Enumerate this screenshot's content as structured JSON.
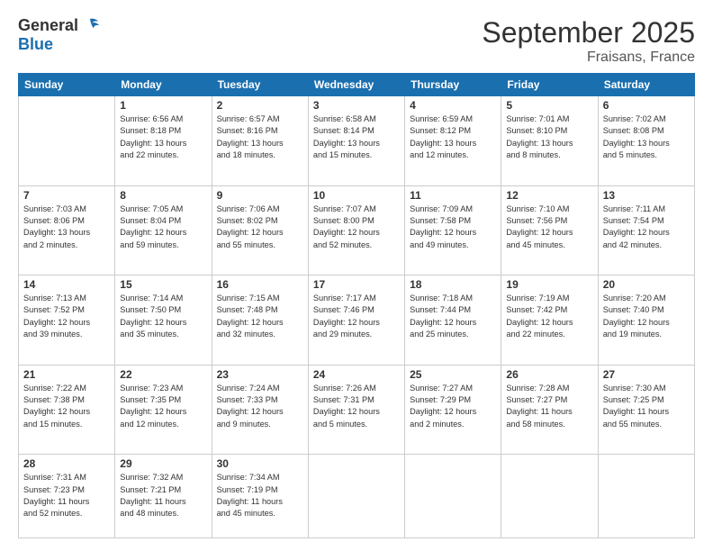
{
  "logo": {
    "general": "General",
    "blue": "Blue"
  },
  "header": {
    "month": "September 2025",
    "location": "Fraisans, France"
  },
  "weekdays": [
    "Sunday",
    "Monday",
    "Tuesday",
    "Wednesday",
    "Thursday",
    "Friday",
    "Saturday"
  ],
  "weeks": [
    [
      {
        "day": "",
        "info": ""
      },
      {
        "day": "1",
        "info": "Sunrise: 6:56 AM\nSunset: 8:18 PM\nDaylight: 13 hours\nand 22 minutes."
      },
      {
        "day": "2",
        "info": "Sunrise: 6:57 AM\nSunset: 8:16 PM\nDaylight: 13 hours\nand 18 minutes."
      },
      {
        "day": "3",
        "info": "Sunrise: 6:58 AM\nSunset: 8:14 PM\nDaylight: 13 hours\nand 15 minutes."
      },
      {
        "day": "4",
        "info": "Sunrise: 6:59 AM\nSunset: 8:12 PM\nDaylight: 13 hours\nand 12 minutes."
      },
      {
        "day": "5",
        "info": "Sunrise: 7:01 AM\nSunset: 8:10 PM\nDaylight: 13 hours\nand 8 minutes."
      },
      {
        "day": "6",
        "info": "Sunrise: 7:02 AM\nSunset: 8:08 PM\nDaylight: 13 hours\nand 5 minutes."
      }
    ],
    [
      {
        "day": "7",
        "info": "Sunrise: 7:03 AM\nSunset: 8:06 PM\nDaylight: 13 hours\nand 2 minutes."
      },
      {
        "day": "8",
        "info": "Sunrise: 7:05 AM\nSunset: 8:04 PM\nDaylight: 12 hours\nand 59 minutes."
      },
      {
        "day": "9",
        "info": "Sunrise: 7:06 AM\nSunset: 8:02 PM\nDaylight: 12 hours\nand 55 minutes."
      },
      {
        "day": "10",
        "info": "Sunrise: 7:07 AM\nSunset: 8:00 PM\nDaylight: 12 hours\nand 52 minutes."
      },
      {
        "day": "11",
        "info": "Sunrise: 7:09 AM\nSunset: 7:58 PM\nDaylight: 12 hours\nand 49 minutes."
      },
      {
        "day": "12",
        "info": "Sunrise: 7:10 AM\nSunset: 7:56 PM\nDaylight: 12 hours\nand 45 minutes."
      },
      {
        "day": "13",
        "info": "Sunrise: 7:11 AM\nSunset: 7:54 PM\nDaylight: 12 hours\nand 42 minutes."
      }
    ],
    [
      {
        "day": "14",
        "info": "Sunrise: 7:13 AM\nSunset: 7:52 PM\nDaylight: 12 hours\nand 39 minutes."
      },
      {
        "day": "15",
        "info": "Sunrise: 7:14 AM\nSunset: 7:50 PM\nDaylight: 12 hours\nand 35 minutes."
      },
      {
        "day": "16",
        "info": "Sunrise: 7:15 AM\nSunset: 7:48 PM\nDaylight: 12 hours\nand 32 minutes."
      },
      {
        "day": "17",
        "info": "Sunrise: 7:17 AM\nSunset: 7:46 PM\nDaylight: 12 hours\nand 29 minutes."
      },
      {
        "day": "18",
        "info": "Sunrise: 7:18 AM\nSunset: 7:44 PM\nDaylight: 12 hours\nand 25 minutes."
      },
      {
        "day": "19",
        "info": "Sunrise: 7:19 AM\nSunset: 7:42 PM\nDaylight: 12 hours\nand 22 minutes."
      },
      {
        "day": "20",
        "info": "Sunrise: 7:20 AM\nSunset: 7:40 PM\nDaylight: 12 hours\nand 19 minutes."
      }
    ],
    [
      {
        "day": "21",
        "info": "Sunrise: 7:22 AM\nSunset: 7:38 PM\nDaylight: 12 hours\nand 15 minutes."
      },
      {
        "day": "22",
        "info": "Sunrise: 7:23 AM\nSunset: 7:35 PM\nDaylight: 12 hours\nand 12 minutes."
      },
      {
        "day": "23",
        "info": "Sunrise: 7:24 AM\nSunset: 7:33 PM\nDaylight: 12 hours\nand 9 minutes."
      },
      {
        "day": "24",
        "info": "Sunrise: 7:26 AM\nSunset: 7:31 PM\nDaylight: 12 hours\nand 5 minutes."
      },
      {
        "day": "25",
        "info": "Sunrise: 7:27 AM\nSunset: 7:29 PM\nDaylight: 12 hours\nand 2 minutes."
      },
      {
        "day": "26",
        "info": "Sunrise: 7:28 AM\nSunset: 7:27 PM\nDaylight: 11 hours\nand 58 minutes."
      },
      {
        "day": "27",
        "info": "Sunrise: 7:30 AM\nSunset: 7:25 PM\nDaylight: 11 hours\nand 55 minutes."
      }
    ],
    [
      {
        "day": "28",
        "info": "Sunrise: 7:31 AM\nSunset: 7:23 PM\nDaylight: 11 hours\nand 52 minutes."
      },
      {
        "day": "29",
        "info": "Sunrise: 7:32 AM\nSunset: 7:21 PM\nDaylight: 11 hours\nand 48 minutes."
      },
      {
        "day": "30",
        "info": "Sunrise: 7:34 AM\nSunset: 7:19 PM\nDaylight: 11 hours\nand 45 minutes."
      },
      {
        "day": "",
        "info": ""
      },
      {
        "day": "",
        "info": ""
      },
      {
        "day": "",
        "info": ""
      },
      {
        "day": "",
        "info": ""
      }
    ]
  ]
}
